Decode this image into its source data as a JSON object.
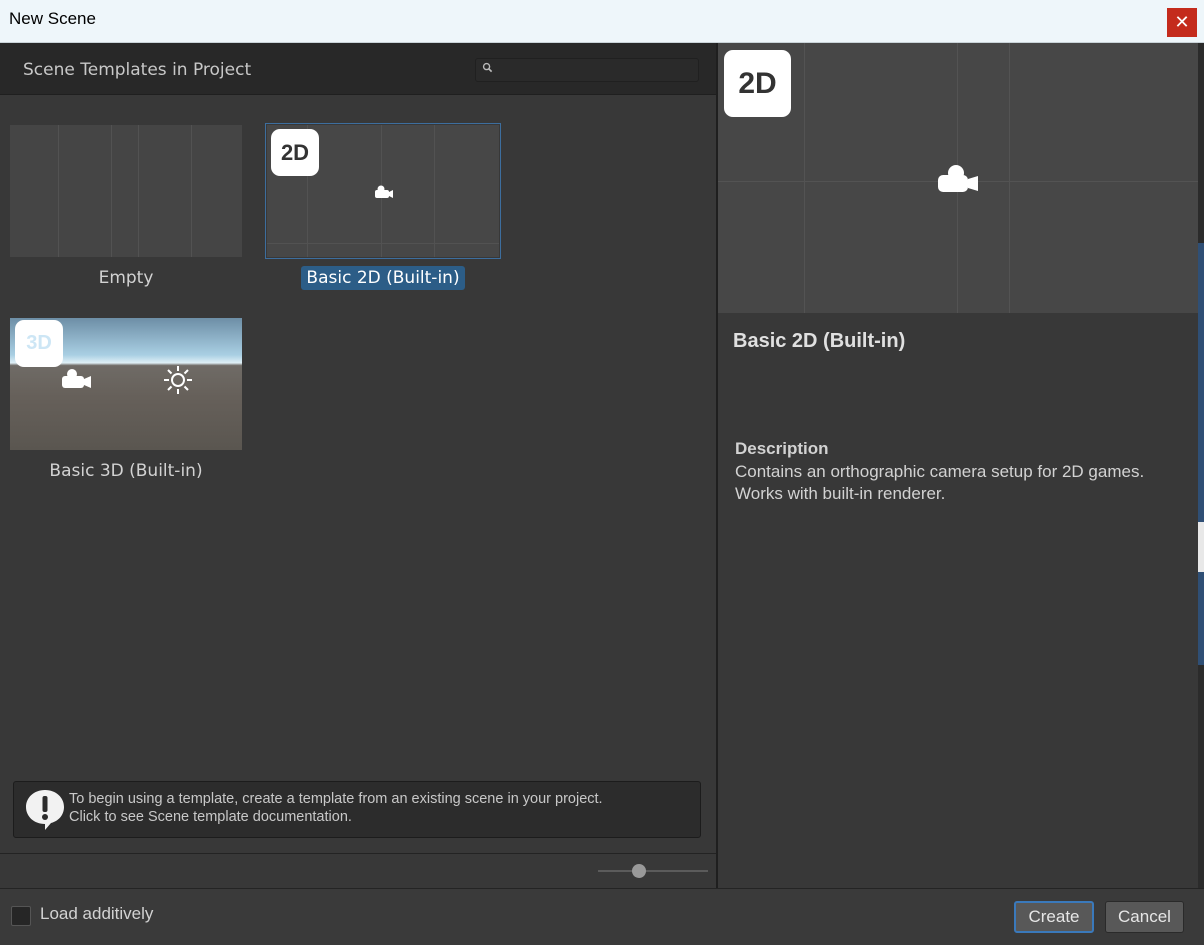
{
  "window": {
    "title": "New Scene",
    "close_glyph": "✕"
  },
  "left_panel": {
    "header_label": "Scene Templates in Project",
    "search": {
      "placeholder": "",
      "value": ""
    },
    "templates": [
      {
        "name": "Empty",
        "badge": "",
        "selected": false
      },
      {
        "name": "Basic 2D (Built-in)",
        "badge": "2D",
        "selected": true
      },
      {
        "name": "Basic 3D (Built-in)",
        "badge": "3D",
        "selected": false
      }
    ],
    "notice": {
      "line1": "To begin using a template, create a template from an existing scene in your project.",
      "line2": "Click to see Scene template documentation."
    },
    "zoom_slider": {
      "value": 0.37
    }
  },
  "details": {
    "badge": "2D",
    "title": "Basic 2D (Built-in)",
    "description_heading": "Description",
    "description_body": "Contains an orthographic camera setup for 2D games. Works with built-in renderer."
  },
  "footer": {
    "load_additively_label": "Load additively",
    "load_additively_checked": false,
    "create_label": "Create",
    "cancel_label": "Cancel"
  },
  "icons": {
    "search": "search-icon",
    "camera": "camera-icon",
    "sun": "sun-icon",
    "info": "info-icon",
    "close": "close-icon"
  },
  "colors": {
    "accent": "#2c5d87",
    "focus_border": "#3a79bb",
    "close_red": "#c42b1c",
    "panel_bg": "#383838"
  }
}
